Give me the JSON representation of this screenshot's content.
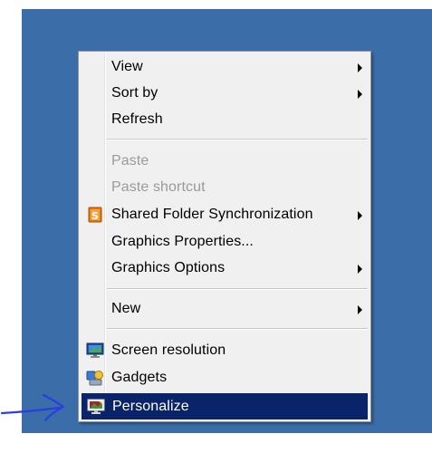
{
  "context_menu": {
    "items": [
      {
        "label": "View",
        "submenu": true
      },
      {
        "label": "Sort by",
        "submenu": true
      },
      {
        "label": "Refresh",
        "submenu": false
      },
      {
        "label": "Paste",
        "disabled": true
      },
      {
        "label": "Paste shortcut",
        "disabled": true
      },
      {
        "label": "Shared Folder Synchronization",
        "submenu": true,
        "icon": "shared-folder-sync-icon"
      },
      {
        "label": "Graphics Properties...",
        "submenu": false
      },
      {
        "label": "Graphics Options",
        "submenu": true
      },
      {
        "label": "New",
        "submenu": true
      },
      {
        "label": "Screen resolution",
        "icon": "screen-resolution-icon"
      },
      {
        "label": "Gadgets",
        "icon": "gadgets-icon"
      },
      {
        "label": "Personalize",
        "icon": "personalize-icon",
        "highlighted": true
      }
    ]
  },
  "colors": {
    "desktop": "#3b6ea8",
    "menu_bg": "#f0f0f0",
    "highlight": "#0a246a",
    "annotation_arrow": "#2a3ee0"
  }
}
